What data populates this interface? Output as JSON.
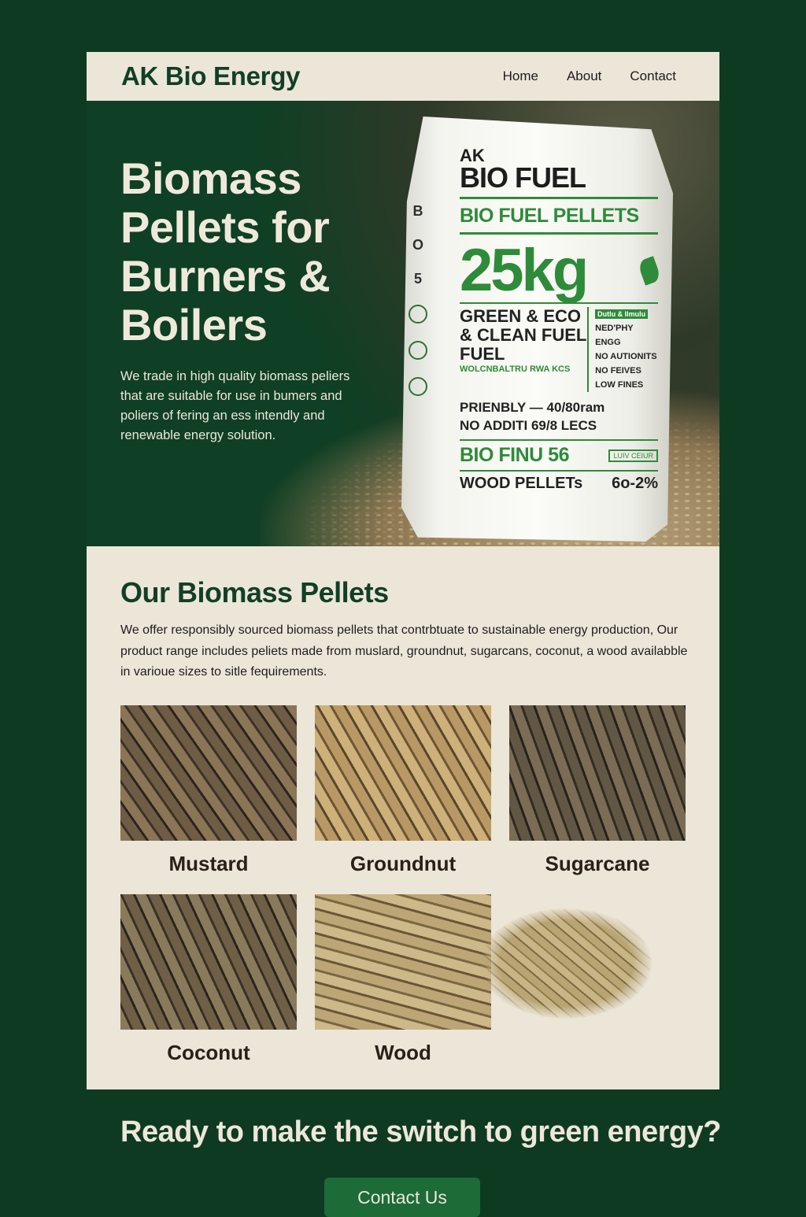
{
  "header": {
    "brand": "AK Bio Energy",
    "nav": [
      "Home",
      "About",
      "Contact"
    ]
  },
  "hero": {
    "title": "Biomass Pellets for Burners & Boilers",
    "description": "We trade in high quality biomass peliers that are suitable for use in bumers and poliers of fering an ess intendly and renewable energy solution.",
    "bag": {
      "ak": "AK",
      "brand": "BIO FUEL",
      "subtitle": "BIO FUEL PELLETS",
      "weight": "25kg",
      "side_text": [
        "B",
        "O",
        "5"
      ],
      "left_lines": [
        "GREEN & ECO",
        "& CLEAN FUEL",
        "FUEL"
      ],
      "left_small": "WOLCNBALTRU RWA KCS",
      "right_lines": [
        "NED'PHY ENGG",
        "NO AUTIONITS",
        "NO FEIVES",
        "LOW FINES"
      ],
      "right_tag": "Dutlu & Ilmulu",
      "row1": "PRIENBLY — 40/80ram",
      "row2": "NO ADDITI 69/8 LECS",
      "fin": "BIO FINU 56",
      "fin_tag": "LUIV CEIUR",
      "wood": "WOOD PELLETs",
      "wood_pct": "6o-2%"
    }
  },
  "products": {
    "title": "Our Biomass Pellets",
    "description": "We offer responsibly sourced biomass pellets that contrbtuate to sustainable energy production, Our product range includes peliets made from muslard, groundnut, sugarcans, coconut, a wood availabble in varioue sizes to sitle fequirements.",
    "items": [
      {
        "label": "Mustard"
      },
      {
        "label": "Groundnut"
      },
      {
        "label": "Sugarcane"
      },
      {
        "label": "Coconut"
      },
      {
        "label": "Wood"
      }
    ]
  },
  "cta": {
    "title": "Ready to make the switch to green energy?",
    "button": "Contact Us"
  }
}
